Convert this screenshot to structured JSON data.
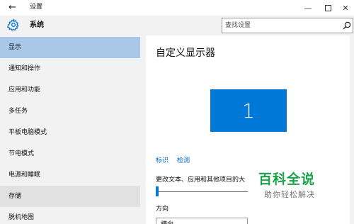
{
  "window": {
    "title": "设置",
    "back_glyph": "←",
    "min_glyph": "—",
    "close_glyph": "✕"
  },
  "header": {
    "section_title": "系统",
    "search_placeholder": "查找设置"
  },
  "sidebar": {
    "items": [
      {
        "label": "显示"
      },
      {
        "label": "通知和操作"
      },
      {
        "label": "应用和功能"
      },
      {
        "label": "多任务"
      },
      {
        "label": "平板电脑模式"
      },
      {
        "label": "节电模式"
      },
      {
        "label": "电源和睡眠"
      },
      {
        "label": "存储"
      },
      {
        "label": "脱机地图"
      }
    ],
    "selected": "显示"
  },
  "main": {
    "title": "自定义显示器",
    "monitor_number": "1",
    "identify_link": "标识",
    "detect_link": "检测",
    "scale_label": "更改文本、应用和其他项目的大",
    "scale_slider_level": 0,
    "orientation_label": "方向",
    "orientation_value": "横向"
  },
  "watermark": {
    "main": "百科全说",
    "sub": "助你轻松解决"
  },
  "colors": {
    "accent": "#0078d7",
    "selected_bg": "#a9c7e6",
    "link": "#0066cc",
    "watermark_green": "#1aa34a"
  },
  "icons": {
    "back": "arrow-left-icon",
    "gear": "gear-icon",
    "search": "search-icon"
  }
}
